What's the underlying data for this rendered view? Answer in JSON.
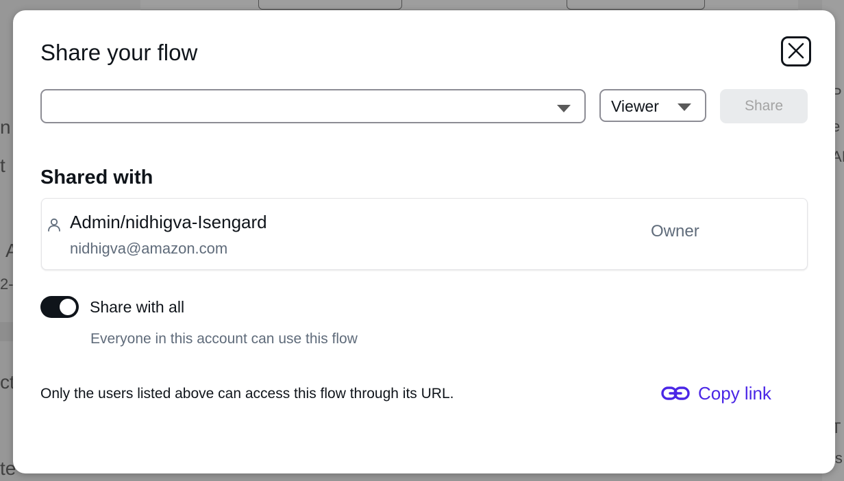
{
  "background": {
    "fragments": [
      "n",
      "t",
      "A",
      "2-",
      "ct",
      "te",
      "P",
      "e",
      "AI",
      "e",
      "T",
      "is"
    ]
  },
  "modal": {
    "title": "Share your flow",
    "close_icon": "close-icon",
    "user_select": {
      "value": "",
      "caret_icon": "caret-down-icon"
    },
    "role_select": {
      "value": "Viewer",
      "caret_icon": "caret-down-icon"
    },
    "share_button": {
      "label": "Share",
      "disabled": true
    }
  },
  "shared_with": {
    "title": "Shared with",
    "users": [
      {
        "icon": "person-icon",
        "name": "Admin/nidhigva-Isengard",
        "email": "nidhigva@amazon.com",
        "role": "Owner"
      }
    ]
  },
  "share_all": {
    "label": "Share with all",
    "description": "Everyone in this account can use this flow",
    "enabled": true
  },
  "footer": {
    "note": "Only the users listed above can access this flow through its URL.",
    "copy_link_label": "Copy link",
    "copy_link_icon": "link-icon"
  },
  "colors": {
    "primary_text": "#0f141a",
    "secondary_text": "#5f6b7a",
    "link": "#4a26e6",
    "disabled_bg": "#e9ebed",
    "disabled_text": "#a3a3a3",
    "border": "#8c8c94"
  }
}
